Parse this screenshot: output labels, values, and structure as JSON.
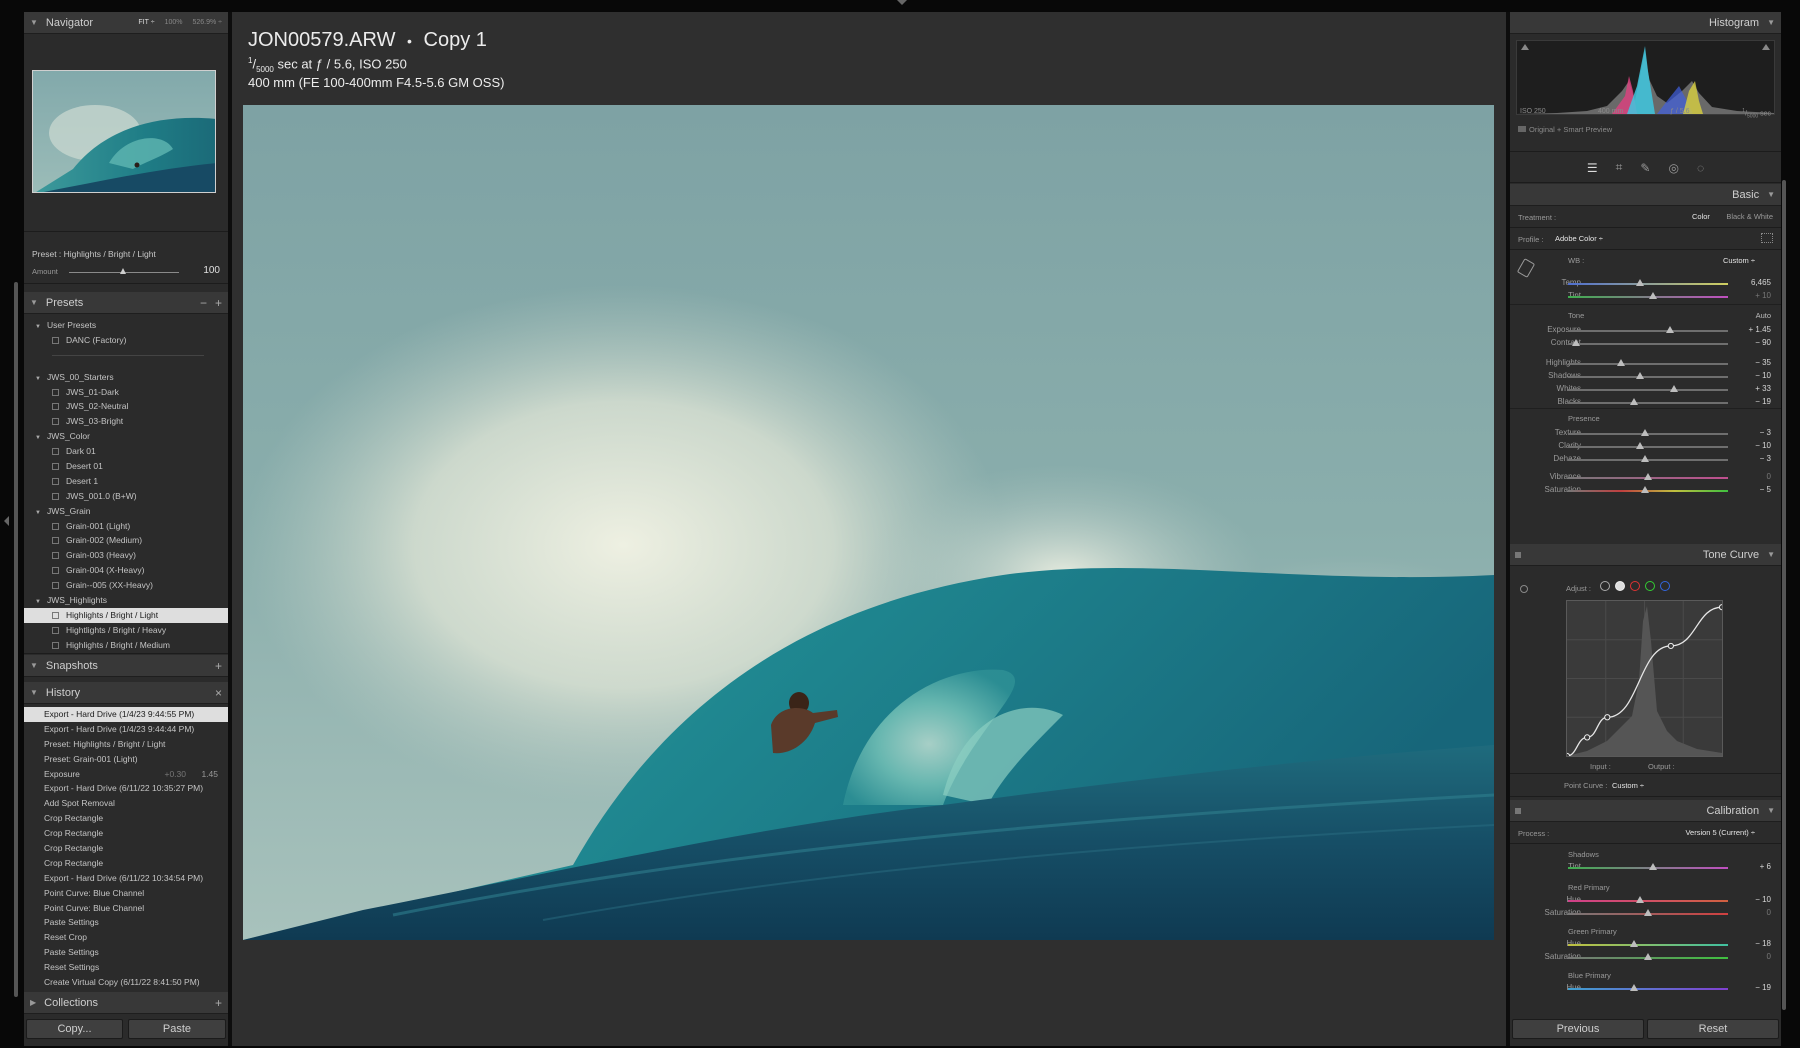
{
  "navigator": {
    "title": "Navigator",
    "zoom_options": [
      "FIT ÷",
      "100%",
      "526.9% ÷"
    ]
  },
  "preset_strip": {
    "preset_label": "Preset : Highlights / Bright / Light",
    "amount_label": "Amount",
    "amount_value": "100"
  },
  "presets": {
    "title": "Presets",
    "items": [
      {
        "kind": "folder",
        "label": "User Presets"
      },
      {
        "kind": "preset",
        "label": "DANC (Factory)"
      },
      {
        "kind": "sep",
        "label": ""
      },
      {
        "kind": "folder",
        "label": "JWS_00_Starters"
      },
      {
        "kind": "preset",
        "label": "JWS_01-Dark"
      },
      {
        "kind": "preset",
        "label": "JWS_02-Neutral"
      },
      {
        "kind": "preset",
        "label": "JWS_03-Bright"
      },
      {
        "kind": "folder",
        "label": "JWS_Color"
      },
      {
        "kind": "preset",
        "label": "Dark 01"
      },
      {
        "kind": "preset",
        "label": "Desert 01"
      },
      {
        "kind": "preset",
        "label": "Desert 1"
      },
      {
        "kind": "preset",
        "label": "JWS_001.0 (B+W)"
      },
      {
        "kind": "folder",
        "label": "JWS_Grain"
      },
      {
        "kind": "preset",
        "label": "Grain-001 (Light)"
      },
      {
        "kind": "preset",
        "label": "Grain-002 (Medium)"
      },
      {
        "kind": "preset",
        "label": "Grain-003 (Heavy)"
      },
      {
        "kind": "preset",
        "label": "Grain-004 (X-Heavy)"
      },
      {
        "kind": "preset",
        "label": "Grain--005 (XX-Heavy)"
      },
      {
        "kind": "folder",
        "label": "JWS_Highlights"
      },
      {
        "kind": "preset",
        "label": "Highlights / Bright / Light",
        "selected": true
      },
      {
        "kind": "preset",
        "label": "Hightlights / Bright / Heavy"
      },
      {
        "kind": "preset",
        "label": "Highlights / Bright / Medium"
      }
    ]
  },
  "snapshots": {
    "title": "Snapshots"
  },
  "history": {
    "title": "History",
    "items": [
      {
        "label": "Export - Hard Drive (1/4/23 9:44:55 PM)",
        "selected": true
      },
      {
        "label": "Export - Hard Drive (1/4/23 9:44:44 PM)"
      },
      {
        "label": "Preset: Highlights / Bright / Light"
      },
      {
        "label": "Preset: Grain-001 (Light)"
      },
      {
        "label": "Exposure",
        "from": "+0.30",
        "to": "1.45"
      },
      {
        "label": "Export - Hard Drive (6/11/22 10:35:27 PM)"
      },
      {
        "label": "Add Spot Removal"
      },
      {
        "label": "Crop Rectangle"
      },
      {
        "label": "Crop Rectangle"
      },
      {
        "label": "Crop Rectangle"
      },
      {
        "label": "Crop Rectangle"
      },
      {
        "label": "Export - Hard Drive (6/11/22 10:34:54 PM)"
      },
      {
        "label": "Point Curve: Blue Channel"
      },
      {
        "label": "Point Curve: Blue Channel"
      },
      {
        "label": "Paste Settings"
      },
      {
        "label": "Reset Crop"
      },
      {
        "label": "Paste Settings"
      },
      {
        "label": "Reset Settings"
      },
      {
        "label": "Create Virtual Copy (6/11/22 8:41:50 PM)"
      }
    ]
  },
  "collections": {
    "title": "Collections"
  },
  "left_buttons": {
    "copy": "Copy...",
    "paste": "Paste"
  },
  "photo": {
    "filename": "JON00579.ARW",
    "dot": "•",
    "copy": "Copy 1",
    "shutter_num": "1",
    "shutter_den": "5000",
    "exposure_rest": " sec at ƒ / 5.6, ISO 250",
    "lens": "400 mm (FE 100-400mm F4.5-5.6 GM OSS)"
  },
  "histogram": {
    "title": "Histogram",
    "iso": "ISO 250",
    "focal": "400 mm",
    "aperture": "ƒ / 5.6",
    "shutter_num": "1",
    "shutter_den": "5000",
    "shutter_unit": "sec",
    "preview": "Original + Smart Preview"
  },
  "tools": [
    "sliders-icon",
    "crop-icon",
    "healing-icon",
    "red-eye-icon",
    "mask-icon"
  ],
  "basic": {
    "title": "Basic",
    "treatment_label": "Treatment :",
    "color": "Color",
    "bw": "Black & White",
    "profile_label": "Profile :",
    "profile_value": "Adobe Color ÷",
    "wb_label": "WB :",
    "wb_value": "Custom ÷",
    "tone_label": "Tone",
    "auto": "Auto",
    "presence_label": "Presence",
    "sliders": [
      {
        "label": "Temp",
        "value": "6,465",
        "pos": 0.45,
        "track": "temp"
      },
      {
        "label": "Tint",
        "value": "+ 10",
        "pos": 0.53,
        "track": "tint",
        "dim": true
      },
      {
        "label": "Exposure",
        "value": "+ 1.45",
        "pos": 0.64
      },
      {
        "label": "Contrast",
        "value": "− 90",
        "pos": 0.05
      },
      {
        "label": "Highlights",
        "value": "− 35",
        "pos": 0.33
      },
      {
        "label": "Shadows",
        "value": "− 10",
        "pos": 0.45
      },
      {
        "label": "Whites",
        "value": "+ 33",
        "pos": 0.66
      },
      {
        "label": "Blacks",
        "value": "− 19",
        "pos": 0.41
      },
      {
        "label": "Texture",
        "value": "− 3",
        "pos": 0.48
      },
      {
        "label": "Clarity",
        "value": "− 10",
        "pos": 0.45
      },
      {
        "label": "Dehaze",
        "value": "− 3",
        "pos": 0.48
      },
      {
        "label": "Vibrance",
        "value": "0",
        "pos": 0.5,
        "track": "vib",
        "dim": true
      },
      {
        "label": "Saturation",
        "value": "− 5",
        "pos": 0.48,
        "track": "sat"
      }
    ]
  },
  "tone_curve": {
    "title": "Tone Curve",
    "adjust_label": "Adjust :",
    "input_label": "Input :",
    "output_label": "Output :",
    "point_curve_label": "Point Curve :",
    "point_curve_value": "Custom ÷",
    "points": [
      [
        0,
        0
      ],
      [
        0.13,
        0.12
      ],
      [
        0.26,
        0.25
      ],
      [
        0.67,
        0.71
      ],
      [
        1,
        0.96
      ]
    ]
  },
  "calibration": {
    "title": "Calibration",
    "process_label": "Process :",
    "process_value": "Version 5 (Current) ÷",
    "shadows_label": "Shadows",
    "red_label": "Red Primary",
    "green_label": "Green Primary",
    "blue_label": "Blue Primary",
    "sliders": [
      {
        "label": "Tint",
        "value": "+ 6",
        "pos": 0.53,
        "track": "tint"
      },
      {
        "label": "Hue",
        "value": "− 10",
        "pos": 0.45,
        "track": "redhue"
      },
      {
        "label": "Saturation",
        "value": "0",
        "pos": 0.5,
        "track": "redsat",
        "dim": true
      },
      {
        "label": "Hue",
        "value": "− 18",
        "pos": 0.41,
        "track": "greenhue"
      },
      {
        "label": "Saturation",
        "value": "0",
        "pos": 0.5,
        "track": "greensat",
        "dim": true
      },
      {
        "label": "Hue",
        "value": "− 19",
        "pos": 0.41,
        "track": "bluehue"
      }
    ]
  },
  "right_buttons": {
    "previous": "Previous",
    "reset": "Reset"
  }
}
